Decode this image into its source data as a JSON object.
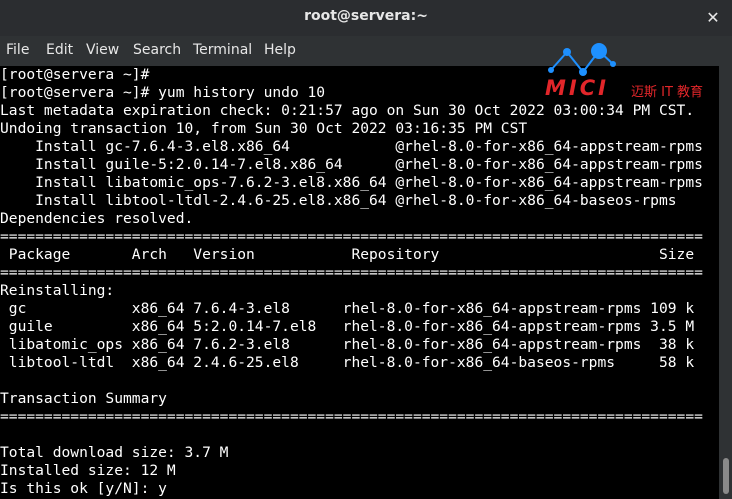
{
  "window": {
    "title": "root@servera:~",
    "close_glyph": "✕"
  },
  "menu": {
    "items": [
      "File",
      "Edit",
      "View",
      "Search",
      "Terminal",
      "Help"
    ]
  },
  "watermark": {
    "brand": "MICI",
    "subtitle": "迈斯 IT 教育",
    "accent_color": "#e2262a",
    "node_color": "#1e90ff"
  },
  "terminal": {
    "lines": [
      "[root@servera ~]#",
      "[root@servera ~]# yum history undo 10",
      "Last metadata expiration check: 0:21:57 ago on Sun 30 Oct 2022 03:00:34 PM CST.",
      "Undoing transaction 10, from Sun 30 Oct 2022 03:16:35 PM CST",
      "    Install gc-7.6.4-3.el8.x86_64            @rhel-8.0-for-x86_64-appstream-rpms",
      "    Install guile-5:2.0.14-7.el8.x86_64      @rhel-8.0-for-x86_64-appstream-rpms",
      "    Install libatomic_ops-7.6.2-3.el8.x86_64 @rhel-8.0-for-x86_64-appstream-rpms",
      "    Install libtool-ltdl-2.4.6-25.el8.x86_64 @rhel-8.0-for-x86_64-baseos-rpms",
      "Dependencies resolved.",
      "================================================================================",
      " Package       Arch   Version           Repository                         Size",
      "================================================================================",
      "Reinstalling:",
      " gc            x86_64 7.6.4-3.el8      rhel-8.0-for-x86_64-appstream-rpms 109 k",
      " guile         x86_64 5:2.0.14-7.el8   rhel-8.0-for-x86_64-appstream-rpms 3.5 M",
      " libatomic_ops x86_64 7.6.2-3.el8      rhel-8.0-for-x86_64-appstream-rpms  38 k",
      " libtool-ltdl  x86_64 2.4.6-25.el8     rhel-8.0-for-x86_64-baseos-rpms     58 k",
      "",
      "Transaction Summary",
      "================================================================================",
      "",
      "Total download size: 3.7 M",
      "Installed size: 12 M",
      "Is this ok [y/N]: y"
    ]
  }
}
